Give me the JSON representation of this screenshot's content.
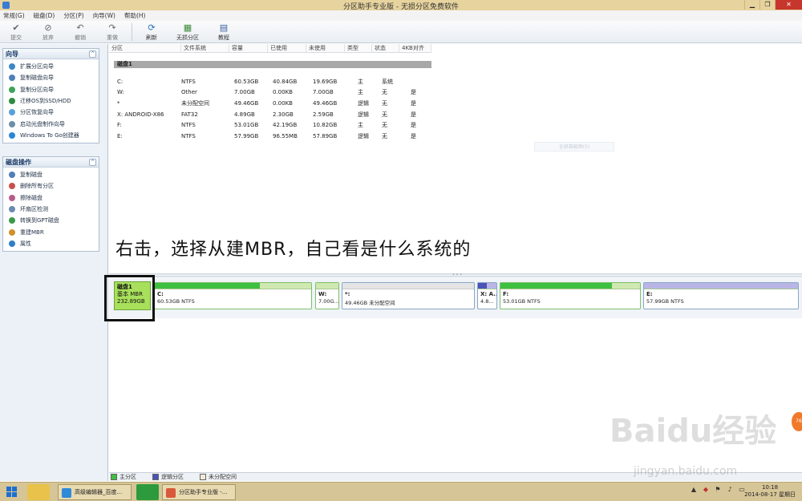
{
  "window": {
    "title": "分区助手专业版 - 无损分区免费软件",
    "minimize": "▁",
    "maximize": "❐",
    "close": "✕"
  },
  "menu": [
    "常规(G)",
    "磁盘(D)",
    "分区(P)",
    "向导(W)",
    "帮助(H)"
  ],
  "toolbar": {
    "commit": "提交",
    "discard": "放弃",
    "undo": "撤销",
    "redo": "重做",
    "refresh": "刷新",
    "lossless": "无损分区",
    "tutorial": "教程"
  },
  "wizard": {
    "title": "向导",
    "items": [
      "扩展分区向导",
      "复制磁盘向导",
      "复制分区向导",
      "迁移OS到SSD/HDD",
      "分区恢复向导",
      "启动光盘制作向导",
      "Windows To Go创建器"
    ]
  },
  "diskops": {
    "title": "磁盘操作",
    "items": [
      "复制磁盘",
      "删除所有分区",
      "擦除磁盘",
      "坏扇区检测",
      "转换到GPT磁盘",
      "重建MBR",
      "属性"
    ]
  },
  "table": {
    "headers": [
      "分区",
      "文件系统",
      "容量",
      "已使用",
      "未使用",
      "类型",
      "状态",
      "4KB对齐"
    ],
    "disk_label": "磁盘1",
    "rows": [
      [
        "C:",
        "NTFS",
        "60.53GB",
        "40.84GB",
        "19.69GB",
        "主",
        "系统",
        ""
      ],
      [
        "W:",
        "Other",
        "7.00GB",
        "0.00KB",
        "7.00GB",
        "主",
        "无",
        "是"
      ],
      [
        "*",
        "未分配空间",
        "49.46GB",
        "0.00KB",
        "49.46GB",
        "逻辑",
        "无",
        "是"
      ],
      [
        "X: ANDROID-X86",
        "FAT32",
        "4.89GB",
        "2.30GB",
        "2.59GB",
        "逻辑",
        "无",
        "是"
      ],
      [
        "F:",
        "NTFS",
        "53.01GB",
        "42.19GB",
        "10.82GB",
        "主",
        "无",
        "是"
      ],
      [
        "E:",
        "NTFS",
        "57.99GB",
        "96.55MB",
        "57.89GB",
        "逻辑",
        "无",
        "是"
      ]
    ],
    "ghost_button": "全屏幕截图(S)"
  },
  "annotation": "右击，选择从建MBR，自己看是什么系统的",
  "diskmap": {
    "disk_name": "磁盘1",
    "disk_type": "基本 MBR",
    "disk_size": "232.89GB",
    "partitions": [
      {
        "name": "C:",
        "info": "60.53GB NTFS",
        "used": 0.67
      },
      {
        "name": "W:",
        "info": "7.00G...",
        "used": 0.0
      },
      {
        "name": "*:",
        "info": "49.46GB 未分配空间",
        "used": 0.0
      },
      {
        "name": "X: A...",
        "info": "4.8...",
        "used": 0.47
      },
      {
        "name": "F:",
        "info": "53.01GB NTFS",
        "used": 0.8
      },
      {
        "name": "E:",
        "info": "57.99GB NTFS",
        "used": 0.0
      }
    ]
  },
  "legend": [
    "主分区",
    "逻辑分区",
    "未分配空间"
  ],
  "watermark": {
    "main": "Baidu经验",
    "sub": "jingyan.baidu.com",
    "badge": "76"
  },
  "taskbar": {
    "task1": "高级编辑器_百度...",
    "task2": "分区助手专业版 -...",
    "time": "10:18",
    "date": "2014-08-17 星期日"
  },
  "colors": {
    "primary_partition": "#3fbf3f",
    "logical_partition": "#4b52b8",
    "unallocated": "#e4e4e4",
    "titlebar": "#e7d39e",
    "disk_label": "#a8e05b"
  }
}
